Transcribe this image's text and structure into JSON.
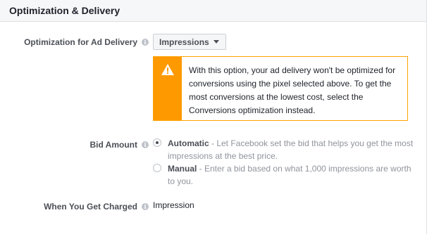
{
  "section": {
    "title": "Optimization & Delivery"
  },
  "optimization": {
    "label": "Optimization for Ad Delivery",
    "selected": "Impressions"
  },
  "warning": {
    "icon": "warning-triangle-icon",
    "color": "#ff9900",
    "message": "With this option, your ad delivery won't be optimized for conversions using the pixel selected above. To get the most conversions at the lowest cost, select the Conversions optimization instead."
  },
  "bid": {
    "label": "Bid Amount",
    "options": [
      {
        "title": "Automatic",
        "description": " - Let Facebook set the bid that helps you get the most impressions at the best price.",
        "checked": true
      },
      {
        "title": "Manual",
        "description": " - Enter a bid based on what 1,000 impressions are worth to you.",
        "checked": false
      }
    ]
  },
  "charged": {
    "label": "When You Get Charged",
    "value": "Impression"
  }
}
